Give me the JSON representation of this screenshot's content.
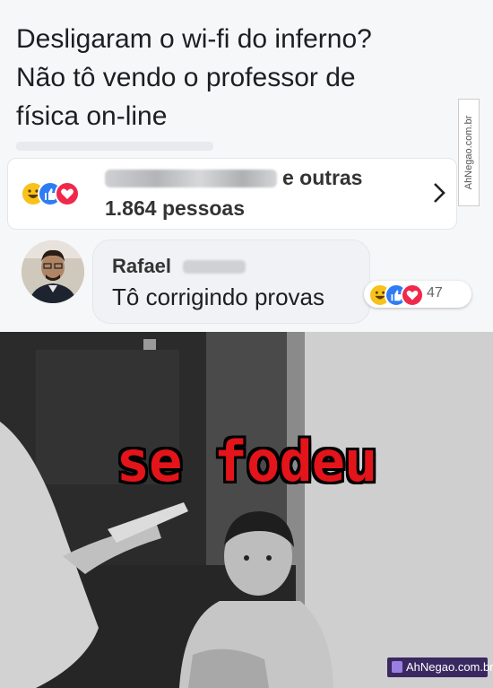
{
  "post": {
    "text": "Desligaram o wi-fi do inferno?\nNão tô vendo o professor de\nfísica on-line"
  },
  "reactions": {
    "names_suffix": "e outras",
    "count": "1.864 pessoas",
    "icons": [
      "haha-icon",
      "like-icon",
      "love-icon"
    ]
  },
  "comment": {
    "author": "Rafael",
    "text": "Tô corrigindo provas",
    "reaction_count": "47"
  },
  "watermark": {
    "side": "AhNegao.com.br",
    "bottom": "AhNegao.com.br"
  },
  "meme": {
    "caption": "se fodeu"
  },
  "colors": {
    "haha": "#f7c21b",
    "like": "#2d7cf6",
    "love": "#f0284a",
    "caption": "#e4141b"
  }
}
